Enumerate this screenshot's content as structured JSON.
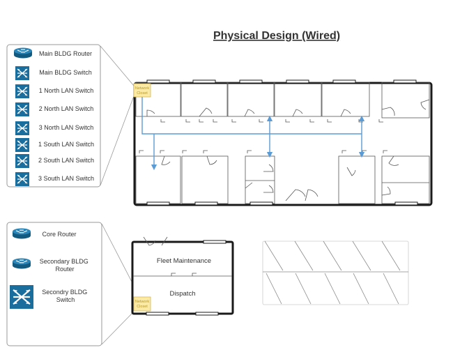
{
  "title": "Physical Design (Wired)",
  "main_building": {
    "legend": [
      {
        "label": "Main BLDG Router",
        "icon": "router-icon"
      },
      {
        "label": "Main BLDG Switch",
        "icon": "switch-icon"
      },
      {
        "label": "1 North LAN Switch",
        "icon": "switch-icon"
      },
      {
        "label": "2 North LAN Switch",
        "icon": "switch-icon"
      },
      {
        "label": "3 North LAN Switch",
        "icon": "switch-icon"
      },
      {
        "label": "1 South LAN Switch",
        "icon": "switch-icon"
      },
      {
        "label": "2 South LAN Switch",
        "icon": "switch-icon"
      },
      {
        "label": "3 South LAN Switch",
        "icon": "switch-icon"
      }
    ],
    "network_closet": "Network Closet"
  },
  "secondary_building": {
    "legend": [
      {
        "label": "Core Router",
        "icon": "router-icon"
      },
      {
        "label": "Secondary BLDG Router",
        "icon": "router-icon"
      },
      {
        "label": "Secondry BLDG Switch",
        "icon": "switch-icon"
      }
    ],
    "rooms": [
      "Fleet Maintenance",
      "Dispatch"
    ],
    "network_closet": "Network Closet"
  },
  "colors": {
    "wall": "#1a1a1a",
    "cable": "#5b9bd5",
    "closet_fill": "#fbeaa5",
    "closet_stroke": "#d6b656",
    "device_blue": "#1a6e9e",
    "legend_border": "#999999"
  }
}
